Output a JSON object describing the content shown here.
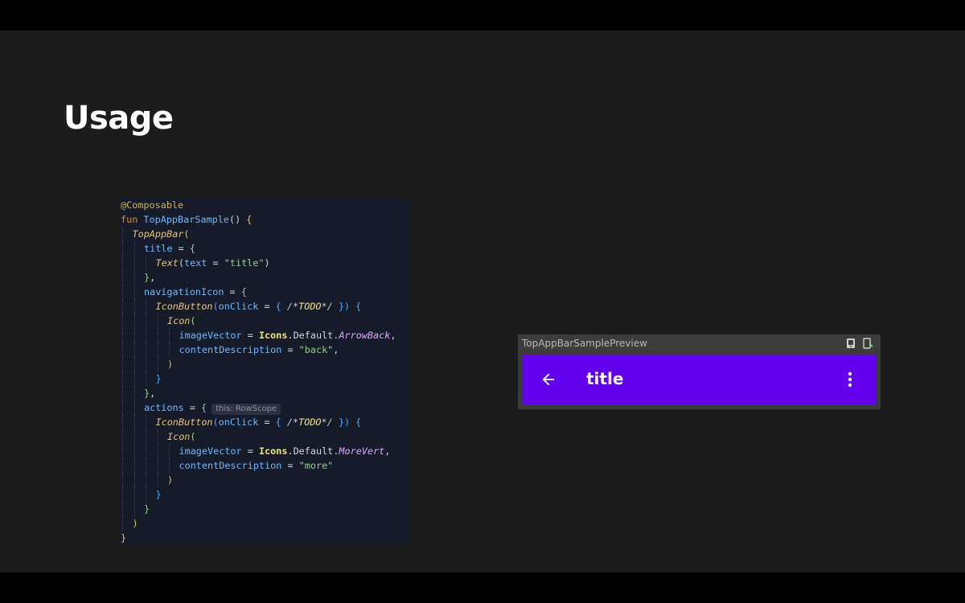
{
  "slide": {
    "title": "Usage"
  },
  "code": {
    "lines": [
      {
        "indent": 0,
        "tokens": [
          {
            "t": "@Composable",
            "c": "k-anno"
          }
        ]
      },
      {
        "indent": 0,
        "tokens": [
          {
            "t": "fun ",
            "c": "k-kw"
          },
          {
            "t": "TopAppBarSample",
            "c": "k-fn"
          },
          {
            "t": "() ",
            "c": "k-plain"
          },
          {
            "t": "{",
            "c": "k-brace-y"
          }
        ]
      },
      {
        "indent": 1,
        "tokens": [
          {
            "t": "TopAppBar",
            "c": "k-call"
          },
          {
            "t": "(",
            "c": "k-brace-y"
          }
        ]
      },
      {
        "indent": 2,
        "tokens": [
          {
            "t": "title",
            "c": "k-param"
          },
          {
            "t": " = ",
            "c": "k-plain"
          },
          {
            "t": "{",
            "c": "k-brace-g"
          }
        ]
      },
      {
        "indent": 3,
        "tokens": [
          {
            "t": "Text",
            "c": "k-call"
          },
          {
            "t": "(",
            "c": "k-plain"
          },
          {
            "t": "text",
            "c": "k-param"
          },
          {
            "t": " = ",
            "c": "k-plain"
          },
          {
            "t": "\"title\"",
            "c": "k-str"
          },
          {
            "t": ")",
            "c": "k-plain"
          }
        ]
      },
      {
        "indent": 2,
        "tokens": [
          {
            "t": "}",
            "c": "k-brace-g"
          },
          {
            "t": ",",
            "c": "k-plain"
          }
        ]
      },
      {
        "indent": 2,
        "tokens": [
          {
            "t": "navigationIcon",
            "c": "k-param"
          },
          {
            "t": " = ",
            "c": "k-plain"
          },
          {
            "t": "{",
            "c": "k-brace-g"
          }
        ]
      },
      {
        "indent": 3,
        "tokens": [
          {
            "t": "IconButton",
            "c": "k-call"
          },
          {
            "t": "(",
            "c": "k-brace-b"
          },
          {
            "t": "onClick",
            "c": "k-param"
          },
          {
            "t": " = ",
            "c": "k-plain"
          },
          {
            "t": "{ ",
            "c": "k-brace-b"
          },
          {
            "t": "/*",
            "c": "k-comment"
          },
          {
            "t": "TODO",
            "c": "k-todo"
          },
          {
            "t": "*/ ",
            "c": "k-comment"
          },
          {
            "t": "}",
            "c": "k-brace-b"
          },
          {
            "t": ") ",
            "c": "k-brace-b"
          },
          {
            "t": "{",
            "c": "k-brace-b"
          }
        ]
      },
      {
        "indent": 4,
        "tokens": [
          {
            "t": "Icon",
            "c": "k-call"
          },
          {
            "t": "(",
            "c": "k-brace-y"
          }
        ]
      },
      {
        "indent": 5,
        "tokens": [
          {
            "t": "imageVector",
            "c": "k-param"
          },
          {
            "t": " = ",
            "c": "k-plain"
          },
          {
            "t": "Icons",
            "c": "k-cls"
          },
          {
            "t": ".Default.",
            "c": "k-plain"
          },
          {
            "t": "ArrowBack",
            "c": "k-ital"
          },
          {
            "t": ",",
            "c": "k-plain"
          }
        ]
      },
      {
        "indent": 5,
        "tokens": [
          {
            "t": "contentDescription",
            "c": "k-param"
          },
          {
            "t": " = ",
            "c": "k-plain"
          },
          {
            "t": "\"back\"",
            "c": "k-str"
          },
          {
            "t": ",",
            "c": "k-plain"
          }
        ]
      },
      {
        "indent": 4,
        "tokens": [
          {
            "t": ")",
            "c": "k-brace-y"
          }
        ]
      },
      {
        "indent": 3,
        "tokens": [
          {
            "t": "}",
            "c": "k-brace-b"
          }
        ]
      },
      {
        "indent": 2,
        "tokens": [
          {
            "t": "}",
            "c": "k-brace-g"
          },
          {
            "t": ",",
            "c": "k-plain"
          }
        ]
      },
      {
        "indent": 2,
        "hint": "this: RowScope",
        "tokens": [
          {
            "t": "actions",
            "c": "k-param"
          },
          {
            "t": " = ",
            "c": "k-plain"
          },
          {
            "t": "{",
            "c": "k-brace-g"
          }
        ]
      },
      {
        "indent": 3,
        "tokens": [
          {
            "t": "IconButton",
            "c": "k-call"
          },
          {
            "t": "(",
            "c": "k-brace-b"
          },
          {
            "t": "onClick",
            "c": "k-param"
          },
          {
            "t": " = ",
            "c": "k-plain"
          },
          {
            "t": "{ ",
            "c": "k-brace-b"
          },
          {
            "t": "/*",
            "c": "k-comment"
          },
          {
            "t": "TODO",
            "c": "k-todo"
          },
          {
            "t": "*/ ",
            "c": "k-comment"
          },
          {
            "t": "}",
            "c": "k-brace-b"
          },
          {
            "t": ") ",
            "c": "k-brace-b"
          },
          {
            "t": "{",
            "c": "k-brace-b"
          }
        ]
      },
      {
        "indent": 4,
        "tokens": [
          {
            "t": "Icon",
            "c": "k-call"
          },
          {
            "t": "(",
            "c": "k-brace-y"
          }
        ]
      },
      {
        "indent": 5,
        "tokens": [
          {
            "t": "imageVector",
            "c": "k-param"
          },
          {
            "t": " = ",
            "c": "k-plain"
          },
          {
            "t": "Icons",
            "c": "k-cls"
          },
          {
            "t": ".Default.",
            "c": "k-plain"
          },
          {
            "t": "MoreVert",
            "c": "k-ital"
          },
          {
            "t": ",",
            "c": "k-plain"
          }
        ]
      },
      {
        "indent": 5,
        "tokens": [
          {
            "t": "contentDescription",
            "c": "k-param"
          },
          {
            "t": " = ",
            "c": "k-plain"
          },
          {
            "t": "\"more\"",
            "c": "k-str"
          }
        ]
      },
      {
        "indent": 4,
        "tokens": [
          {
            "t": ")",
            "c": "k-brace-y"
          }
        ]
      },
      {
        "indent": 3,
        "tokens": [
          {
            "t": "}",
            "c": "k-brace-b"
          }
        ]
      },
      {
        "indent": 2,
        "tokens": [
          {
            "t": "}",
            "c": "k-brace-g"
          }
        ]
      },
      {
        "indent": 1,
        "tokens": [
          {
            "t": ")",
            "c": "k-brace-y"
          }
        ]
      },
      {
        "indent": 0,
        "tokens": [
          {
            "t": "}",
            "c": "k-brace-y"
          }
        ]
      }
    ]
  },
  "preview": {
    "name": "TopAppBarSamplePreview",
    "header_icons": [
      "deploy-preview-icon",
      "interactive-preview-icon"
    ],
    "appbar": {
      "title": "title",
      "background": "#6200ee",
      "nav_icon": "arrow-back-icon",
      "action_icon": "more-vert-icon"
    }
  }
}
